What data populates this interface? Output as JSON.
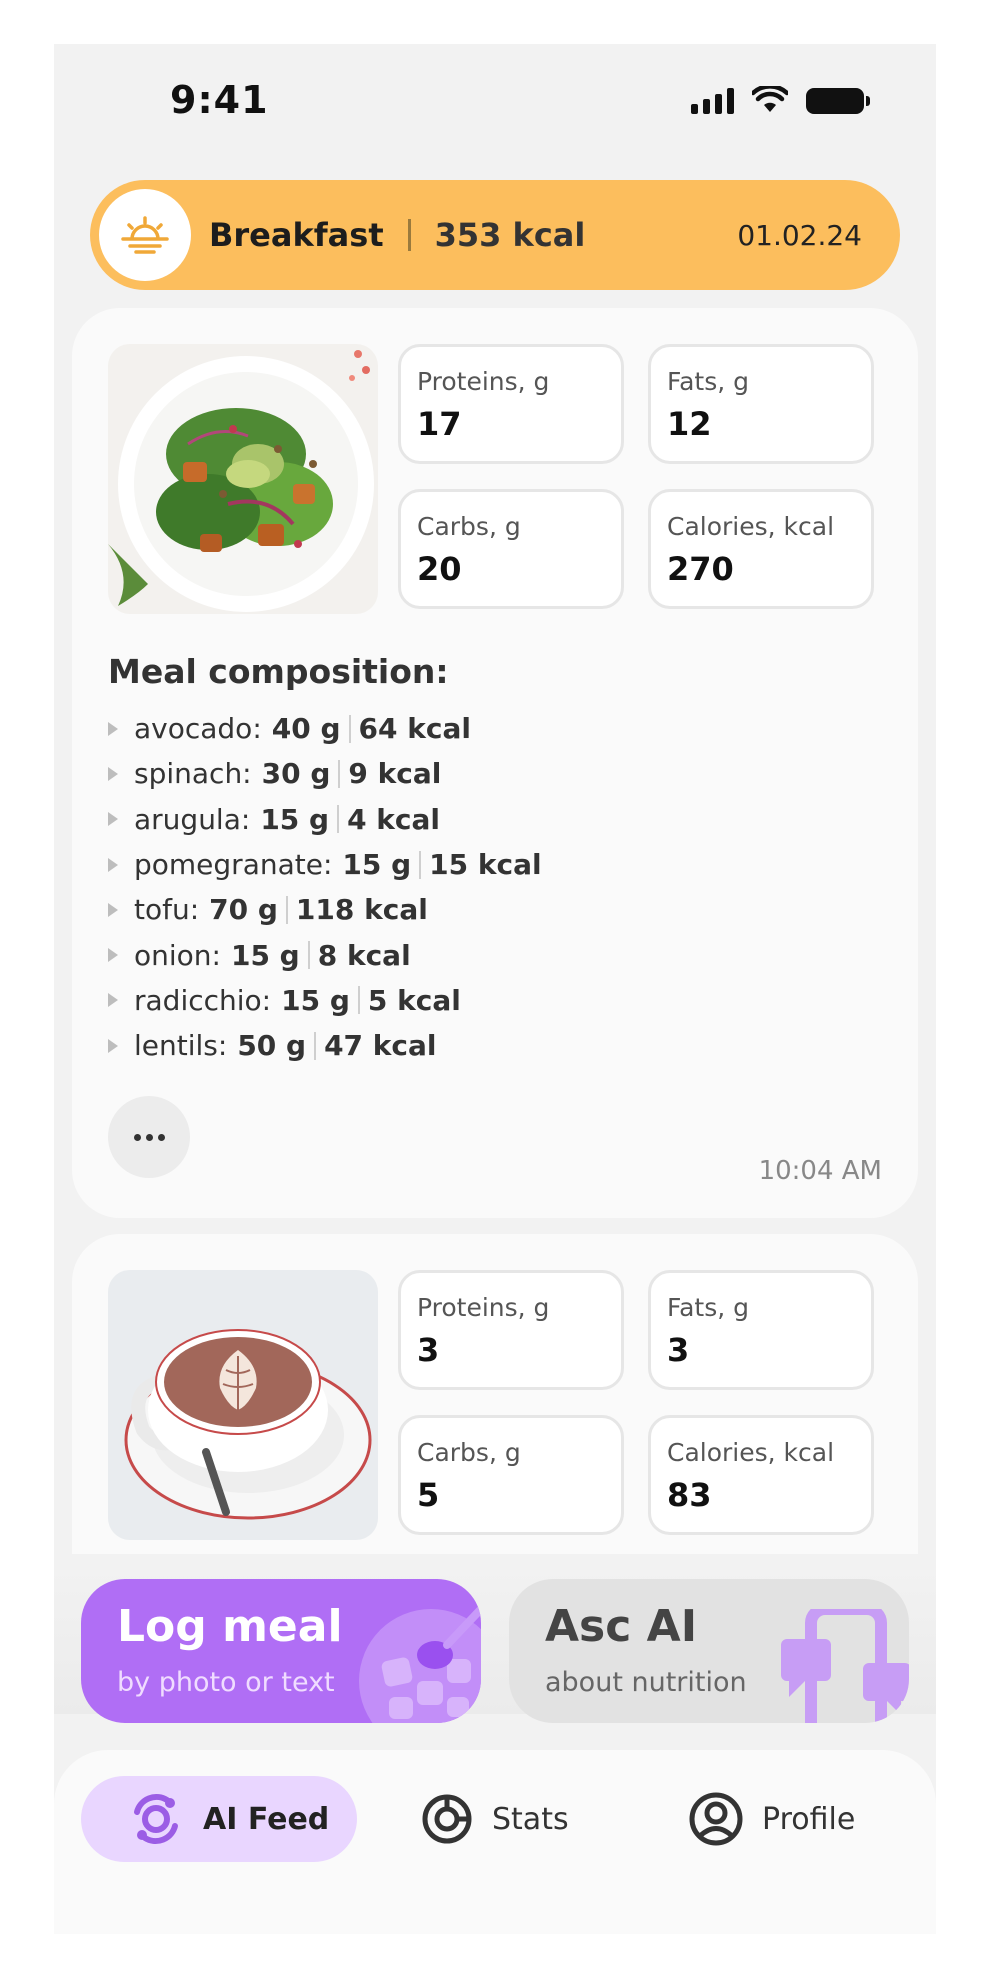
{
  "status_bar": {
    "time": "9:41"
  },
  "meal_header": {
    "name": "Breakfast",
    "kcal": "353 kcal",
    "date": "01.02.24"
  },
  "cards": [
    {
      "image": "salad-photo",
      "macros": {
        "proteins_label": "Proteins, g",
        "proteins": "17",
        "fats_label": "Fats, g",
        "fats": "12",
        "carbs_label": "Carbs, g",
        "carbs": "20",
        "calories_label": "Calories, kcal",
        "calories": "270"
      },
      "composition_title": "Meal composition:",
      "composition": [
        {
          "name": "avocado:",
          "grams": "40 g",
          "kcal": "64 kcal"
        },
        {
          "name": "spinach:",
          "grams": "30 g",
          "kcal": "9 kcal"
        },
        {
          "name": "arugula:",
          "grams": "15 g",
          "kcal": "4 kcal"
        },
        {
          "name": "pomegranate:",
          "grams": "15 g",
          "kcal": "15 kcal"
        },
        {
          "name": "tofu:",
          "grams": "70 g",
          "kcal": "118 kcal"
        },
        {
          "name": "onion:",
          "grams": "15 g",
          "kcal": "8 kcal"
        },
        {
          "name": "radicchio:",
          "grams": "15 g",
          "kcal": "5 kcal"
        },
        {
          "name": "lentils:",
          "grams": "50 g",
          "kcal": "47 kcal"
        }
      ],
      "time": "10:04 AM"
    },
    {
      "image": "cappuccino-photo",
      "macros": {
        "proteins_label": "Proteins, g",
        "proteins": "3",
        "fats_label": "Fats, g",
        "fats": "3",
        "carbs_label": "Carbs, g",
        "carbs": "5",
        "calories_label": "Calories, kcal",
        "calories": "83"
      }
    }
  ],
  "actions": {
    "log_meal": {
      "title": "Log meal",
      "subtitle": "by photo or text"
    },
    "ask_ai": {
      "title": "Asc AI",
      "subtitle": "about nutrition"
    }
  },
  "nav": {
    "feed": "AI Feed",
    "stats": "Stats",
    "profile": "Profile"
  },
  "colors": {
    "header_accent": "#fcbe5d",
    "primary_purple": "#b06ef5",
    "nav_active_bg": "#e9d6ff",
    "nav_active_icon": "#9b5de5"
  }
}
